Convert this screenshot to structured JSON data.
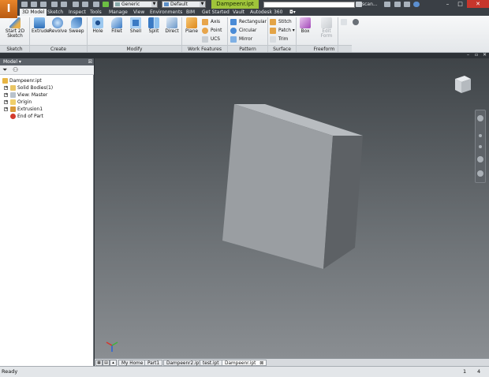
{
  "title_bar": {
    "app_logo": "I",
    "appearance_combo": "Generic",
    "view_rep_combo": "Default",
    "document_title": "Dampeenr.ipt",
    "user_name": "scan..."
  },
  "ribbon_tabs": [
    "3D Model",
    "Sketch",
    "Inspect",
    "Tools",
    "Manage",
    "View",
    "Environments",
    "BIM",
    "Get Started",
    "Vault",
    "Autodesk 360"
  ],
  "ribbon": {
    "sketch": {
      "button": "Start 2D Sketch",
      "panel": "Sketch"
    },
    "create": {
      "buttons": [
        "Extrude",
        "Revolve",
        "Sweep"
      ],
      "panel": "Create"
    },
    "modify": {
      "buttons": [
        "Hole",
        "Fillet",
        "Shell",
        "Split",
        "Direct"
      ],
      "panel": "Modify"
    },
    "work_features": {
      "large": "Plane",
      "small": [
        "Axis",
        "Point",
        "UCS"
      ],
      "panel": "Work Features"
    },
    "pattern": {
      "small": [
        "Rectangular",
        "Circular",
        "Mirror"
      ],
      "panel": "Pattern"
    },
    "surface": {
      "small": [
        "Stitch",
        "Patch",
        "Trim"
      ],
      "panel": "Surface"
    },
    "freeform": {
      "buttons": [
        "Box",
        "Edit Form"
      ],
      "panel": "Freeform"
    }
  },
  "browser": {
    "title": "Model",
    "items": [
      "Dampeenr.ipt",
      "Solid Bodies(1)",
      "View: Master",
      "Origin",
      "Extrusion1",
      "End of Part"
    ]
  },
  "document_tabs": [
    "My Home",
    "Part1",
    "Dampeenr2.ipt",
    "test.ipt",
    "Dampeenr.ipt"
  ],
  "status_bar": {
    "message": "Ready",
    "count_a": "1",
    "count_b": "4"
  },
  "colors": {
    "accent_title": "#9fc43a",
    "viewport_top": "#3f4448",
    "viewport_bottom": "#8a8e92",
    "model_front": "#9a9ea2",
    "model_side": "#5d6165",
    "close_button": "#c7362c"
  }
}
